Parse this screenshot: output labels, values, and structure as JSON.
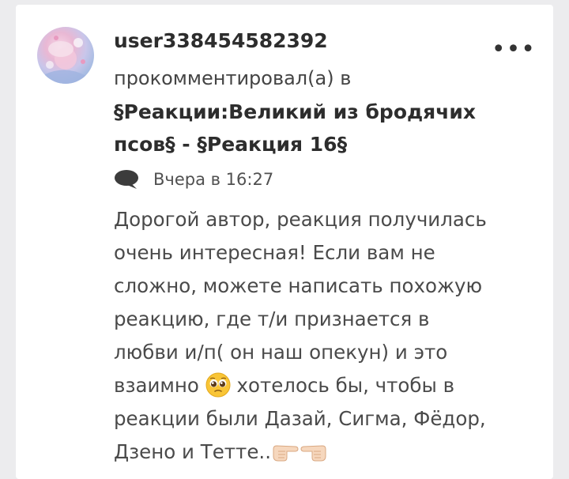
{
  "comment": {
    "username": "user338454582392",
    "action": "прокомментировал(а) в",
    "target_line1": "§Реакции:Великий из бродячих",
    "target_line2": "псов§ - §Реакция 16§",
    "time": "Вчера в 16:27",
    "body_lines": [
      "Дорогой автор, реакция получилась",
      "очень интересная! Если вам не",
      "сложно, можете написать похожую",
      "реакцию, где т/и признается в",
      "любви и/п( он наш опекун) и это"
    ],
    "line6_before": "взаимно ",
    "line6_after": " хотелось бы, чтобы в",
    "line7": "реакции были Дазай, Сигма, Фёдор,",
    "line8": "Дзено и Тетте..",
    "emojis": [
      "pleading-face-emoji",
      "pointing-right-hand-emoji",
      "pointing-left-hand-emoji"
    ],
    "avatar_colors": [
      "#f7d6e6",
      "#c9c6ea",
      "#8fa7d6"
    ]
  }
}
